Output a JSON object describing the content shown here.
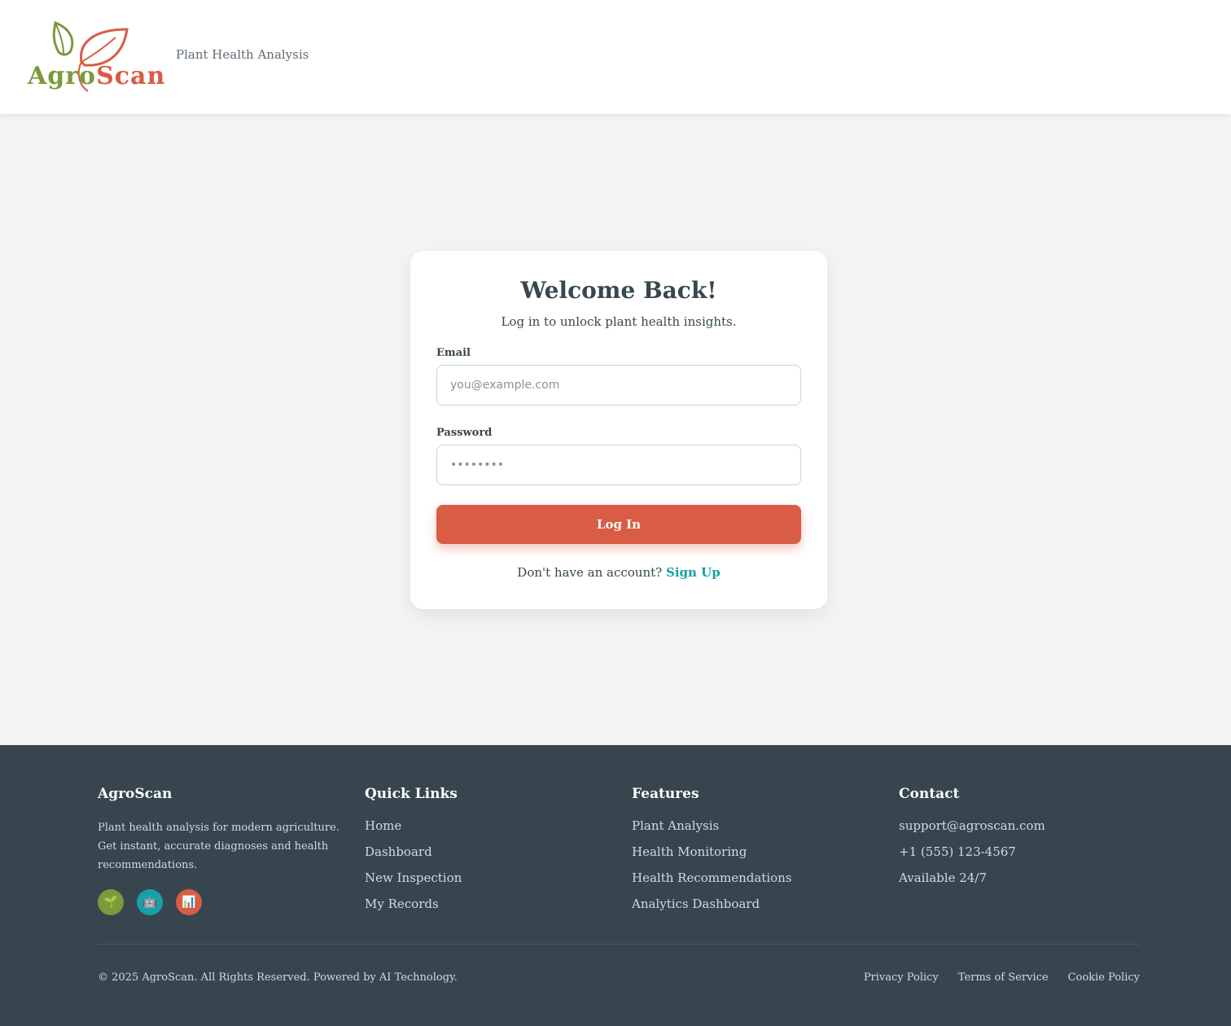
{
  "header": {
    "logo_agro": "Agro",
    "logo_scan": "Scan",
    "tagline": "Plant Health Analysis"
  },
  "login": {
    "title": "Welcome Back!",
    "subtitle": "Log in to unlock plant health insights.",
    "email_label": "Email",
    "email_placeholder": "you@example.com",
    "email_value": "",
    "password_label": "Password",
    "password_placeholder": "••••••••",
    "password_value": "",
    "submit_label": "Log In",
    "signup_prompt": "Don't have an account?",
    "signup_link": "Sign Up"
  },
  "footer": {
    "brand": {
      "title": "AgroScan",
      "description": "Plant health analysis for modern agriculture. Get instant, accurate diagnoses and health recommendations.",
      "icons": [
        {
          "name": "seedling-icon",
          "glyph": "🌱",
          "color": "#7a9a3c"
        },
        {
          "name": "robot-icon",
          "glyph": "🤖",
          "color": "#16a0a8"
        },
        {
          "name": "bar-chart-icon",
          "glyph": "📊",
          "color": "#d95c44"
        }
      ]
    },
    "quick_links": {
      "title": "Quick Links",
      "items": [
        "Home",
        "Dashboard",
        "New Inspection",
        "My Records"
      ]
    },
    "features": {
      "title": "Features",
      "items": [
        "Plant Analysis",
        "Health Monitoring",
        "Health Recommendations",
        "Analytics Dashboard"
      ]
    },
    "contact": {
      "title": "Contact",
      "items": [
        "support@agroscan.com",
        "+1 (555) 123-4567",
        "Available 24/7"
      ]
    },
    "copyright": "© 2025 AgroScan. All Rights Reserved. Powered by AI Technology.",
    "legal": [
      "Privacy Policy",
      "Terms of Service",
      "Cookie Policy"
    ]
  },
  "colors": {
    "primary": "#d95c44",
    "green": "#7a9a3c",
    "teal": "#16a0a8",
    "footer_bg": "#37454f"
  }
}
